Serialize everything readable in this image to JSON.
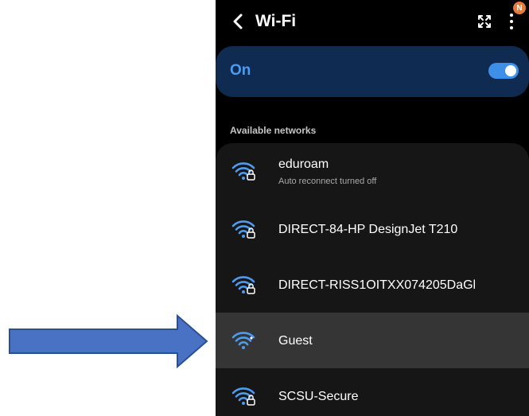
{
  "header": {
    "title": "Wi-Fi",
    "badge": "N"
  },
  "toggle": {
    "label": "On",
    "state": "on"
  },
  "section_label": "Available networks",
  "networks": [
    {
      "name": "eduroam",
      "status": "Auto reconnect turned off",
      "secured": true
    },
    {
      "name": "DIRECT-84-HP DesignJet T210",
      "status": "",
      "secured": true
    },
    {
      "name": "DIRECT-RISS1OITXX074205DaGl",
      "status": "",
      "secured": true
    },
    {
      "name": "Guest",
      "status": "",
      "secured": false,
      "highlighted": true
    },
    {
      "name": "SCSU-Secure",
      "status": "",
      "secured": true
    }
  ],
  "colors": {
    "accent": "#4d9bf0",
    "toggle_bg": "#0f2b52",
    "list_bg": "#161616",
    "highlight_row": "#353535",
    "arrow_fill": "#4a72c4",
    "arrow_stroke": "#2b4f93",
    "badge": "#e9793b"
  },
  "icons": {
    "back": "chevron-left-icon",
    "expand": "expand-icon",
    "more": "more-vertical-icon",
    "wifi": "wifi-icon",
    "lock": "lock-icon",
    "pointer": "arrow-right-icon"
  }
}
